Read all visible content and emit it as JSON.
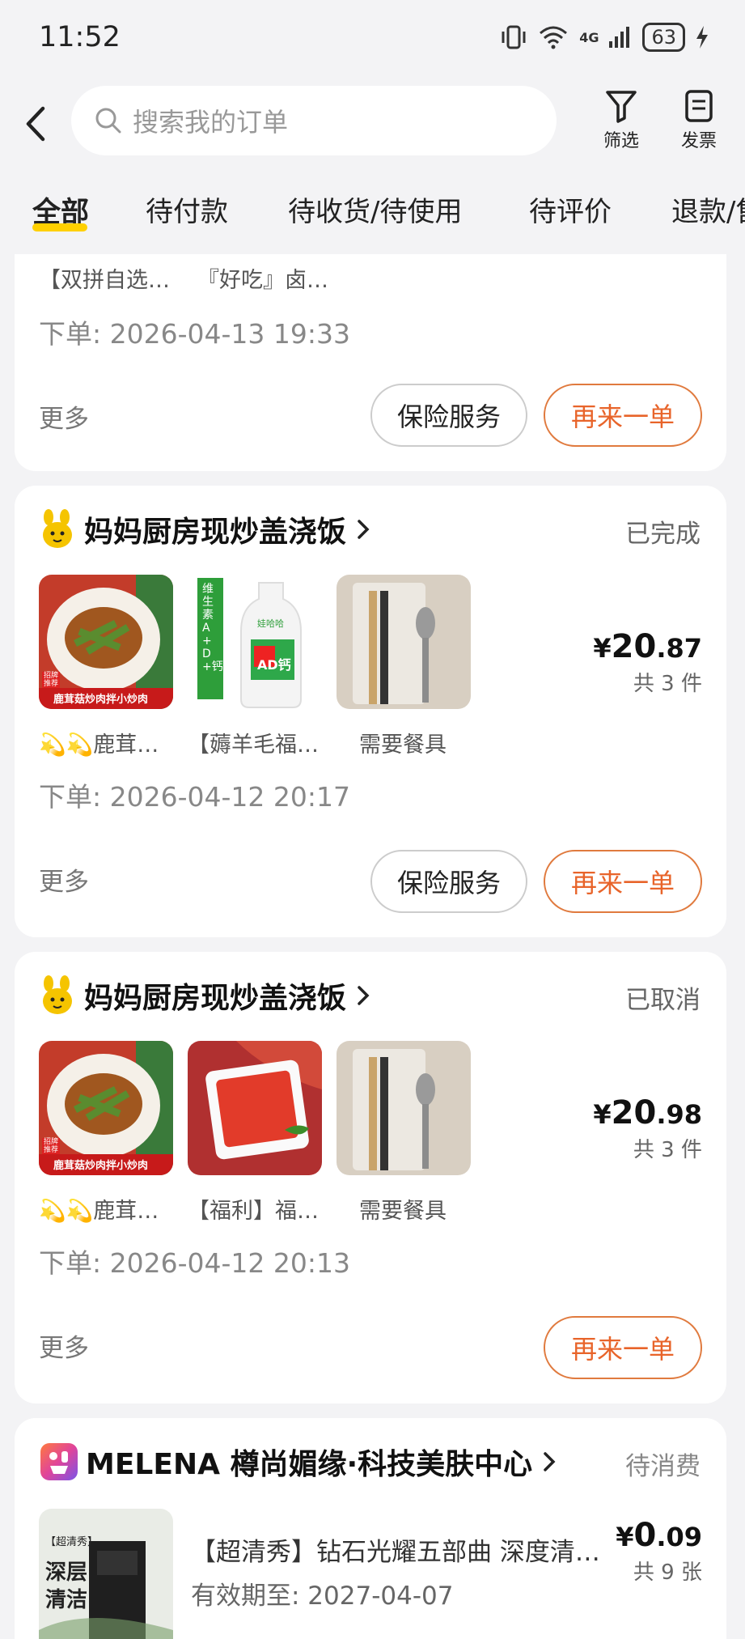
{
  "status_bar": {
    "time": "11:52",
    "network": "4G",
    "battery": "63"
  },
  "header": {
    "search_placeholder": "搜索我的订单",
    "filter_label": "筛选",
    "invoice_label": "发票"
  },
  "tabs": [
    {
      "label": "全部",
      "active": true
    },
    {
      "label": "待付款"
    },
    {
      "label": "待收货/待使用"
    },
    {
      "label": "待评价"
    },
    {
      "label": "退款/售后"
    }
  ],
  "orders": [
    {
      "item_labels": [
        "【双拼自选…",
        "『好吃』卤…"
      ],
      "order_time": "下单: 2026-04-13 19:33",
      "more": "更多",
      "insurance_button": "保险服务",
      "reorder_button": "再来一单"
    },
    {
      "shop": "妈妈厨房现炒盖浇饭",
      "status": "已完成",
      "items": [
        "💫💫鹿茸…",
        "【薅羊毛福…",
        "需要餐具"
      ],
      "price_symbol": "¥",
      "price_int": "20",
      "price_dec": ".87",
      "count": "共 3 件",
      "order_time": "下单: 2026-04-12 20:17",
      "more": "更多",
      "insurance_button": "保险服务",
      "reorder_button": "再来一单"
    },
    {
      "shop": "妈妈厨房现炒盖浇饭",
      "status": "已取消",
      "items": [
        "💫💫鹿茸…",
        "【福利】福…",
        "需要餐具"
      ],
      "price_symbol": "¥",
      "price_int": "20",
      "price_dec": ".98",
      "count": "共 3 件",
      "order_time": "下单: 2026-04-12 20:13",
      "more": "更多",
      "reorder_button": "再来一单"
    },
    {
      "shop": "MELENA 樽尚媚缘·科技美肤中心",
      "status": "待消费",
      "item_title": "【超清秀】钻石光耀五部曲 深度清…",
      "validity": "有效期至: 2027-04-07",
      "price_symbol": "¥",
      "price_int": "0",
      "price_dec": ".09",
      "count": "共 9 张",
      "thumb_text_1": "【超清秀】",
      "thumb_text_2": "深层",
      "thumb_text_3": "清洁"
    }
  ],
  "thumb_captions": {
    "dish": "鹿茸菇炒肉拌小炒肉",
    "badge": "招牌推荐",
    "bottle_side": "维生素A+D+钙",
    "bottle_brand": "娃哈哈",
    "bottle_ad": "AD钙"
  },
  "colors": {
    "accent_orange": "#e8642a",
    "tab_underline": "#ffd000",
    "background": "#f3f3f5"
  }
}
